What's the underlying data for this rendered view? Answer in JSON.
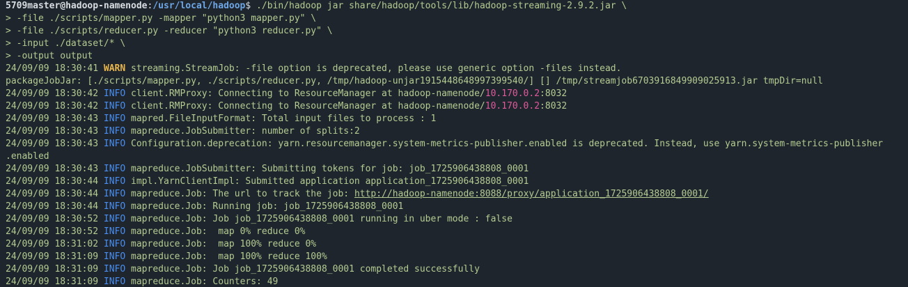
{
  "colors": {
    "background": "#1e252d",
    "text": "#b4cc92",
    "info": "#4a8ef0",
    "warn": "#e8b64c",
    "ip": "#e05a9c",
    "path": "#6ea6e6"
  },
  "prompt": {
    "user_host": "5709master@hadoop-namenode",
    "sep": ":",
    "path": "/usr/local/hadoop",
    "symbol": "$ ",
    "command": "./bin/hadoop jar share/hadoop/tools/lib/hadoop-streaming-2.9.2.jar \\"
  },
  "continuations": [
    "> -file ./scripts/mapper.py -mapper \"python3 mapper.py\" \\",
    "> -file ./scripts/reducer.py -reducer \"python3 reducer.py\" \\",
    "> -input ./dataset/* \\",
    "> -output output"
  ],
  "log": {
    "warn": {
      "ts": "24/09/09 18:30:41 ",
      "level": "WARN",
      "msg": " streaming.StreamJob: -file option is deprecated, please use generic option -files instead."
    },
    "jar": "packageJobJar: [./scripts/mapper.py, ./scripts/reducer.py, /tmp/hadoop-unjar1915448648997399540/] [] /tmp/streamjob6703916849909025913.jar tmpDir=null",
    "rm1": {
      "ts": "24/09/09 18:30:42 ",
      "level": "INFO",
      "msg": " client.RMProxy: Connecting to ResourceManager at hadoop-namenode/",
      "ip": "10.170.0.2",
      "tail": ":8032"
    },
    "rm2": {
      "ts": "24/09/09 18:30:42 ",
      "level": "INFO",
      "msg": " client.RMProxy: Connecting to ResourceManager at hadoop-namenode/",
      "ip": "10.170.0.2",
      "tail": ":8032"
    },
    "fif": {
      "ts": "24/09/09 18:30:43 ",
      "level": "INFO",
      "msg": " mapred.FileInputFormat: Total input files to process : 1"
    },
    "splits": {
      "ts": "24/09/09 18:30:43 ",
      "level": "INFO",
      "msg": " mapreduce.JobSubmitter: number of splits:2"
    },
    "deprec": {
      "ts": "24/09/09 18:30:43 ",
      "level": "INFO",
      "msg": " Configuration.deprecation: yarn.resourcemanager.system-metrics-publisher.enabled is deprecated. Instead, use yarn.system-metrics-publisher",
      "wrap": ".enabled"
    },
    "tokens": {
      "ts": "24/09/09 18:30:43 ",
      "level": "INFO",
      "msg": " mapreduce.JobSubmitter: Submitting tokens for job: job_1725906438808_0001"
    },
    "yarn": {
      "ts": "24/09/09 18:30:44 ",
      "level": "INFO",
      "msg": " impl.YarnClientImpl: Submitted application application_1725906438808_0001"
    },
    "track": {
      "ts": "24/09/09 18:30:44 ",
      "level": "INFO",
      "msg": " mapreduce.Job: The url to track the job: ",
      "url": "http://hadoop-namenode:8088/proxy/application_1725906438808_0001/"
    },
    "running": {
      "ts": "24/09/09 18:30:44 ",
      "level": "INFO",
      "msg": " mapreduce.Job: Running job: job_1725906438808_0001"
    },
    "uber": {
      "ts": "24/09/09 18:30:52 ",
      "level": "INFO",
      "msg": " mapreduce.Job: Job job_1725906438808_0001 running in uber mode : false"
    },
    "p0": {
      "ts": "24/09/09 18:30:52 ",
      "level": "INFO",
      "msg": " mapreduce.Job:  map 0% reduce 0%"
    },
    "p1": {
      "ts": "24/09/09 18:31:02 ",
      "level": "INFO",
      "msg": " mapreduce.Job:  map 100% reduce 0%"
    },
    "p2": {
      "ts": "24/09/09 18:31:09 ",
      "level": "INFO",
      "msg": " mapreduce.Job:  map 100% reduce 100%"
    },
    "done": {
      "ts": "24/09/09 18:31:09 ",
      "level": "INFO",
      "msg": " mapreduce.Job: Job job_1725906438808_0001 completed successfully"
    },
    "counters": {
      "ts": "24/09/09 18:31:09 ",
      "level": "INFO",
      "msg": " mapreduce.Job: Counters: 49"
    }
  }
}
